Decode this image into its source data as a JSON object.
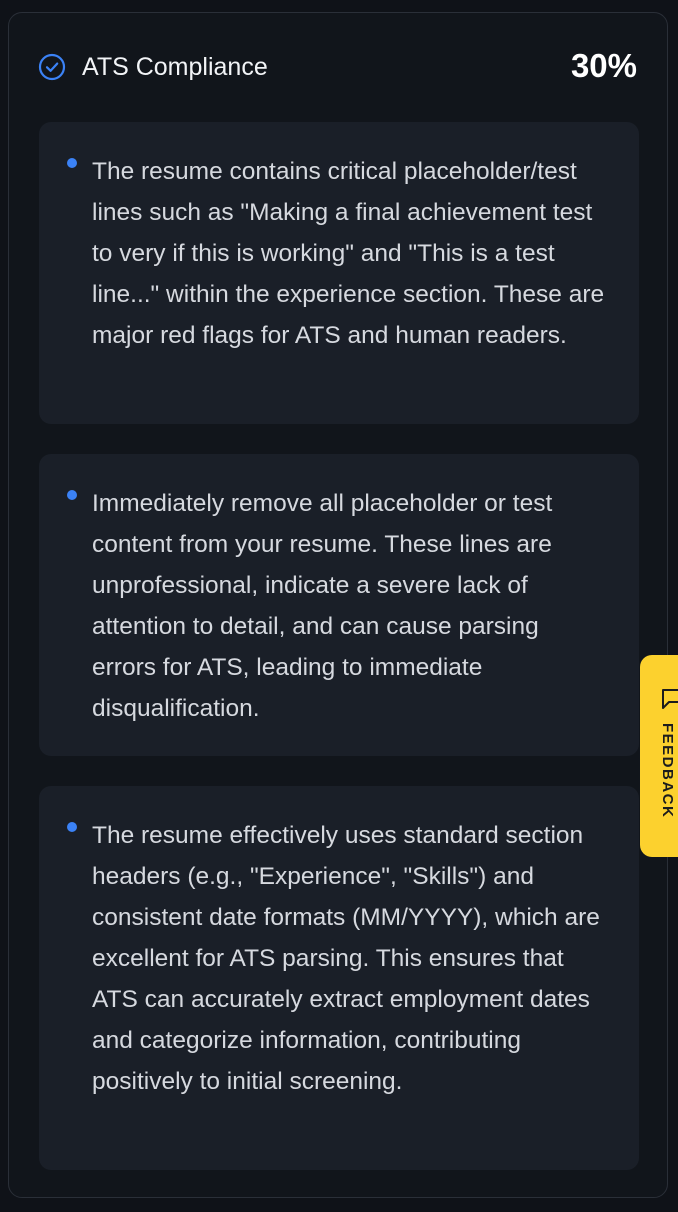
{
  "header": {
    "title": "ATS Compliance",
    "score": "30%",
    "icon": "check-circle-icon",
    "accent_color": "#3b82f6"
  },
  "items": [
    {
      "text": "The resume contains critical placeholder/test lines such as \"Making a final achievement test to very if this is working\" and \"This is a test line...\" within the experience section. These are major red flags for ATS and human readers."
    },
    {
      "text": "Immediately remove all placeholder or test content from your resume. These lines are unprofessional, indicate a severe lack of attention to detail, and can cause parsing errors for ATS, leading to immediate disqualification."
    },
    {
      "text": "The resume effectively uses standard section headers (e.g., \"Experience\", \"Skills\") and consistent date formats (MM/YYYY), which are excellent for ATS parsing. This ensures that ATS can accurately extract employment dates and categorize information, contributing positively to initial screening."
    }
  ],
  "feedback": {
    "label": "FEEDBACK",
    "icon": "message-icon",
    "color": "#fcd12e"
  }
}
